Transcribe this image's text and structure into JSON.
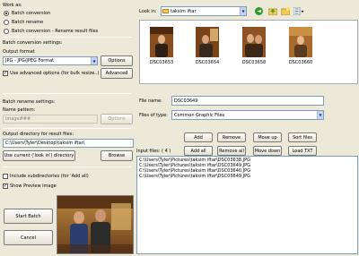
{
  "work_as": {
    "label": "Work as:",
    "options": [
      "Batch conversion",
      "Batch rename",
      "Batch conversion - Rename result files"
    ],
    "selected": 0
  },
  "conversion": {
    "section_label": "Batch conversion settings:",
    "output_format_label": "Output format",
    "format_value": "JPG - JPG/JPEG Format",
    "options_button": "Options",
    "advanced_checkbox": "Use advanced options (for bulk resize..)",
    "advanced_checked": true,
    "advanced_button": "Advanced"
  },
  "rename": {
    "section_label": "Batch rename settings:",
    "pattern_label": "Name pattern:",
    "pattern_value": "image###",
    "options_button": "Options"
  },
  "output": {
    "label": "Output directory for result files:",
    "path": "C:\\Users\\Tyler\\Desktop\\taksim iftar\\",
    "use_current_button": "Use current ('look in') directory",
    "browse_button": "Browse"
  },
  "checkboxes": {
    "subdirs_label": "Include subdirectories (for 'Add all)",
    "subdirs_checked": false,
    "preview_label": "Show Preview image",
    "preview_checked": true
  },
  "actions": {
    "start": "Start Batch",
    "cancel": "Cancel"
  },
  "browser": {
    "look_in_label": "Look in:",
    "folder": "taksim iftar",
    "thumbnails": [
      "DSC03653",
      "DSC03654",
      "DSC03658",
      "DSC03660"
    ],
    "file_name_label": "File name:",
    "file_name": "DSC03649",
    "file_type_label": "Files of type:",
    "file_type": "Common Graphic Files"
  },
  "list_buttons": {
    "add": "Add",
    "remove": "Remove",
    "move_up": "Move up",
    "sort_files": "Sort files",
    "add_all": "Add all",
    "remove_all": "Remove all",
    "move_down": "Move down",
    "load_txt": "Load TXT"
  },
  "input_files": {
    "label": "Input files: ( 4 )",
    "files": [
      "C:\\Users\\Tyler\\Pictures\\taksim iftar\\DSC03638.JPG",
      "C:\\Users\\Tyler\\Pictures\\taksim iftar\\DSC03649.JPG",
      "C:\\Users\\Tyler\\Pictures\\taksim iftar\\DSC03640.JPG",
      "C:\\Users\\Tyler\\Pictures\\taksim iftar\\DSC03649.JPG"
    ]
  }
}
